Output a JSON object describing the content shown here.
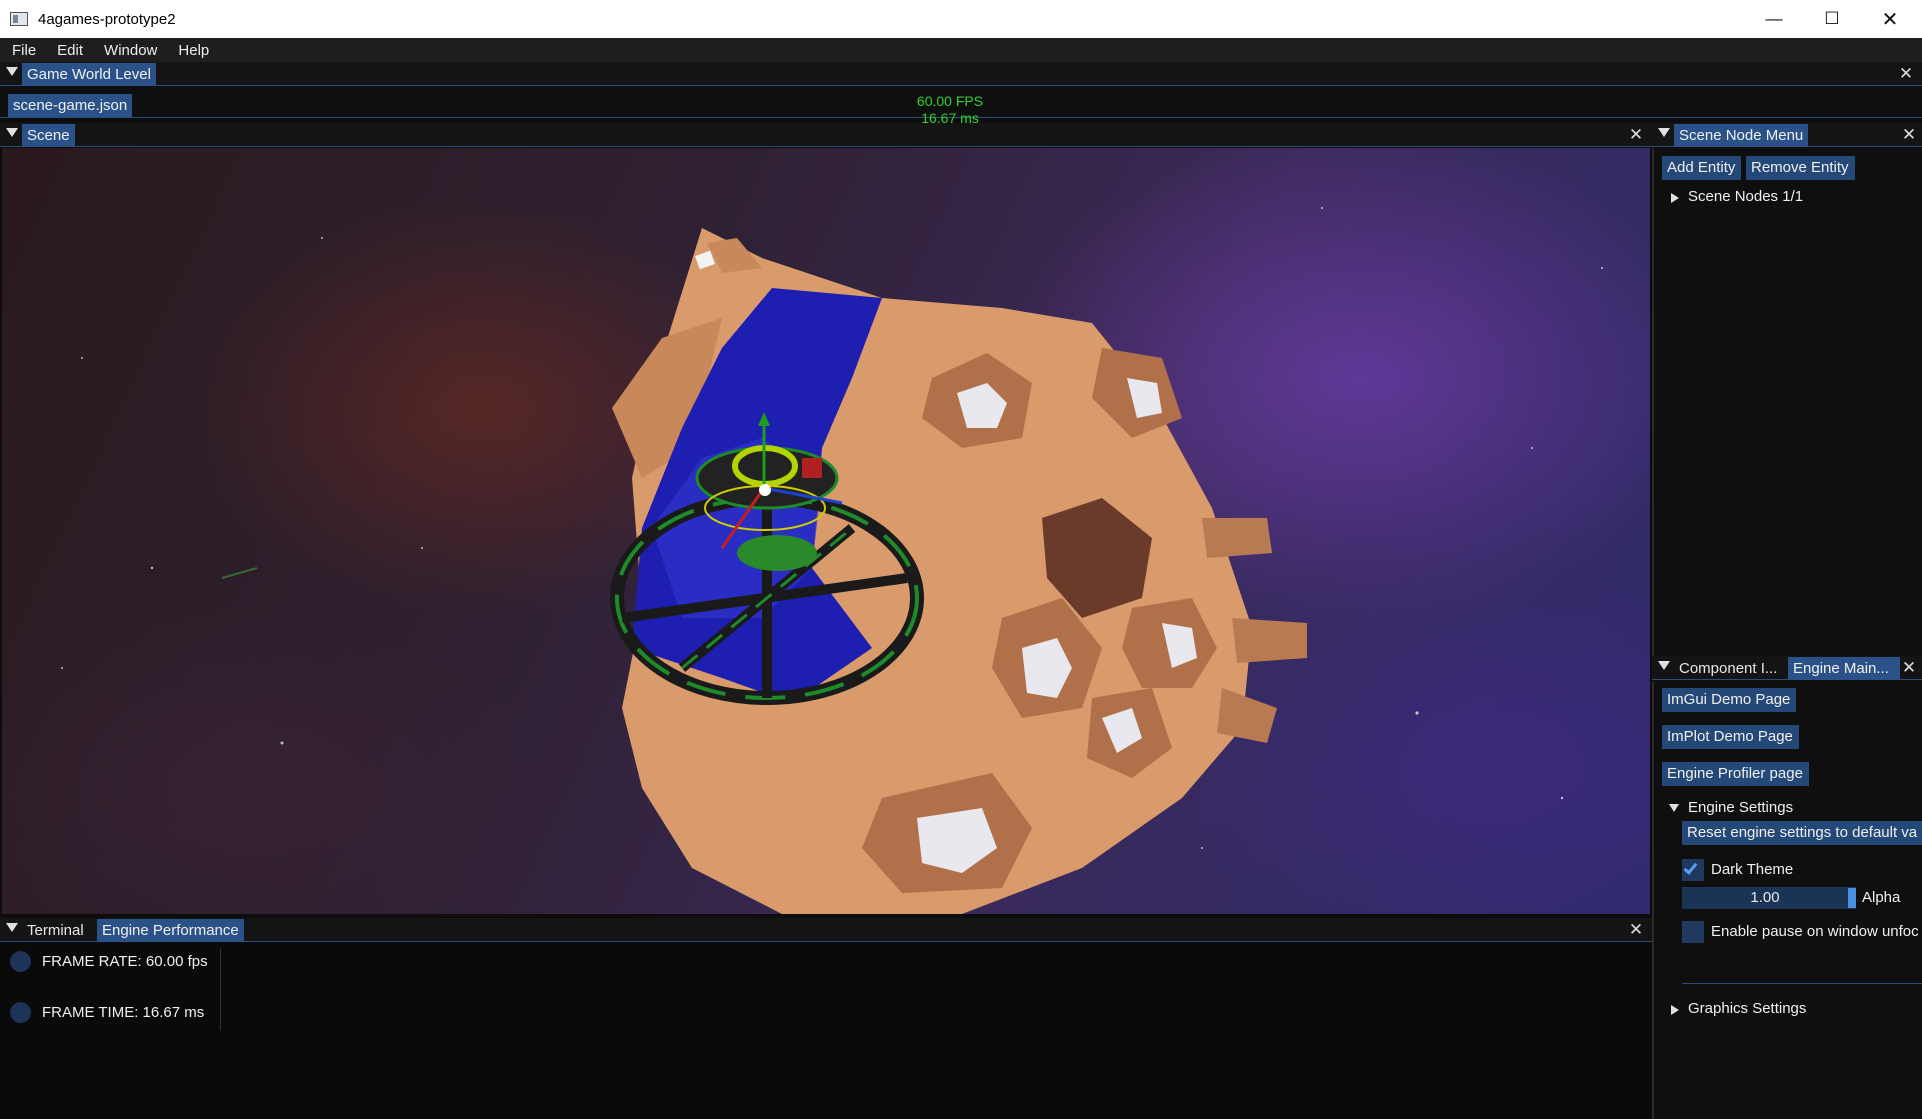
{
  "window": {
    "title": "4agames-prototype2",
    "minimize": "—",
    "maximize": "☐",
    "close": "✕"
  },
  "menu": {
    "items": [
      "File",
      "Edit",
      "Window",
      "Help"
    ]
  },
  "game_world": {
    "tab": "Game World Level",
    "file_tab": "scene-game.json",
    "fps": "60.00 FPS",
    "ms": "16.67 ms"
  },
  "scene": {
    "tab": "Scene"
  },
  "scene_node_menu": {
    "tab": "Scene Node Menu",
    "add_entity": "Add Entity",
    "remove_entity": "Remove Entity",
    "nodes": "Scene Nodes 1/1"
  },
  "bottom_right": {
    "tabs": [
      "Component I...",
      "Engine Main..."
    ],
    "imgui_demo": "ImGui Demo Page",
    "implot_demo": "ImPlot Demo Page",
    "profiler": "Engine Profiler page",
    "engine_settings": "Engine Settings",
    "reset": "Reset engine settings to default va",
    "dark_theme": "Dark Theme",
    "dark_theme_checked": true,
    "alpha_value": "1.00",
    "alpha_label": "Alpha",
    "alpha_fraction": 1.0,
    "pause_label": "Enable pause on window unfoc",
    "pause_checked": false,
    "graphics_settings": "Graphics Settings"
  },
  "bottom": {
    "tabs": [
      "Terminal",
      "Engine Performance"
    ],
    "frame_rate": "FRAME RATE: 60.00 fps",
    "frame_time": "FRAME TIME: 16.67 ms"
  },
  "colors": {
    "accent": "#2a5289",
    "button": "#244878",
    "fps_text": "#2fd22f",
    "asteroid": "#d99a6c",
    "shield": "#1e1fb0",
    "ring": "#1f8a2a"
  }
}
